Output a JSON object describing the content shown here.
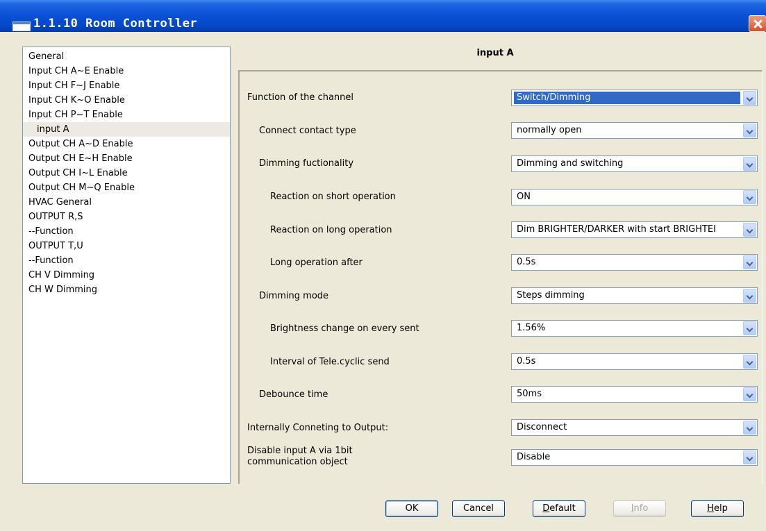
{
  "window": {
    "title": "1.1.10 Room Controller"
  },
  "tree": {
    "items": [
      {
        "label": "General"
      },
      {
        "label": "Input CH A~E Enable"
      },
      {
        "label": "Input CH F~J Enable"
      },
      {
        "label": "Input CH K~O Enable"
      },
      {
        "label": "Input CH P~T Enable"
      },
      {
        "label": "input A",
        "selected": true
      },
      {
        "label": "Output CH A~D Enable"
      },
      {
        "label": "Output CH E~H Enable"
      },
      {
        "label": "Output CH I~L Enable"
      },
      {
        "label": "Output CH M~Q Enable"
      },
      {
        "label": "HVAC General"
      },
      {
        "label": "OUTPUT R,S"
      },
      {
        "label": "--Function"
      },
      {
        "label": "OUTPUT T,U"
      },
      {
        "label": "--Function"
      },
      {
        "label": "CH V Dimming"
      },
      {
        "label": "CH W Dimming"
      }
    ]
  },
  "panel": {
    "title": "input A"
  },
  "params": [
    {
      "label": "Function of the channel",
      "value": "Switch/Dimming"
    },
    {
      "label": "Connect contact type",
      "value": "normally open"
    },
    {
      "label": "Dimming fuctionality",
      "value": "Dimming and switching"
    },
    {
      "label": "Reaction on short operation",
      "value": "ON"
    },
    {
      "label": "Reaction on long operation",
      "value": "Dim BRIGHTER/DARKER with start BRIGHTEI"
    },
    {
      "label": "Long operation after",
      "value": "0.5s"
    },
    {
      "label": "Dimming mode",
      "value": "Steps dimming"
    },
    {
      "label": "Brightness change on every sent",
      "value": "1.56%"
    },
    {
      "label": "Interval of Tele.cyclic send",
      "value": "0.5s"
    },
    {
      "label": "Debounce time",
      "value": "50ms"
    },
    {
      "label": "Internally Conneting to Output:",
      "value": "Disconnect"
    },
    {
      "label_line1": "Disable input A via 1bit",
      "label_line2": "communication object",
      "value": "Disable"
    }
  ],
  "buttons": {
    "ok": "OK",
    "cancel": "Cancel",
    "default_first": "D",
    "default_rest": "efault",
    "info_first": "I",
    "info_rest": "nfo",
    "help_first": "H",
    "help_rest": "elp"
  }
}
